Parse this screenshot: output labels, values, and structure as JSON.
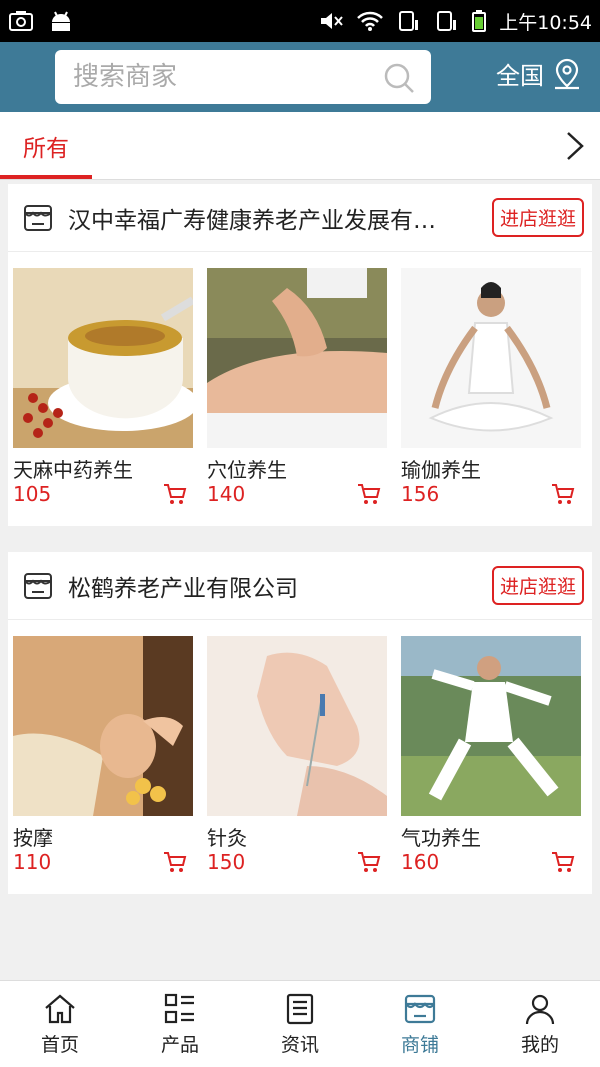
{
  "status_bar": {
    "time": "上午10:54"
  },
  "search": {
    "placeholder": "搜索商家"
  },
  "region": {
    "label": "全国"
  },
  "tabs": {
    "active": "所有"
  },
  "shops": [
    {
      "name": "汉中幸福广寿健康养老产业发展有…",
      "visit_label": "进店逛逛",
      "products": [
        {
          "name": "天麻中药养生",
          "price": "105"
        },
        {
          "name": "穴位养生",
          "price": "140"
        },
        {
          "name": "瑜伽养生",
          "price": "156"
        }
      ]
    },
    {
      "name": "松鹤养老产业有限公司",
      "visit_label": "进店逛逛",
      "products": [
        {
          "name": "按摩",
          "price": "110"
        },
        {
          "name": "针灸",
          "price": "150"
        },
        {
          "name": "气功养生",
          "price": "160"
        }
      ]
    }
  ],
  "bottom_nav": [
    {
      "label": "首页",
      "icon": "home-icon"
    },
    {
      "label": "产品",
      "icon": "grid-list-icon"
    },
    {
      "label": "资讯",
      "icon": "news-icon"
    },
    {
      "label": "商铺",
      "icon": "shop-icon",
      "active": true
    },
    {
      "label": "我的",
      "icon": "user-icon"
    }
  ],
  "colors": {
    "header": "#3e7a97",
    "accent": "#dd2222",
    "active_nav": "#3e7a97"
  }
}
